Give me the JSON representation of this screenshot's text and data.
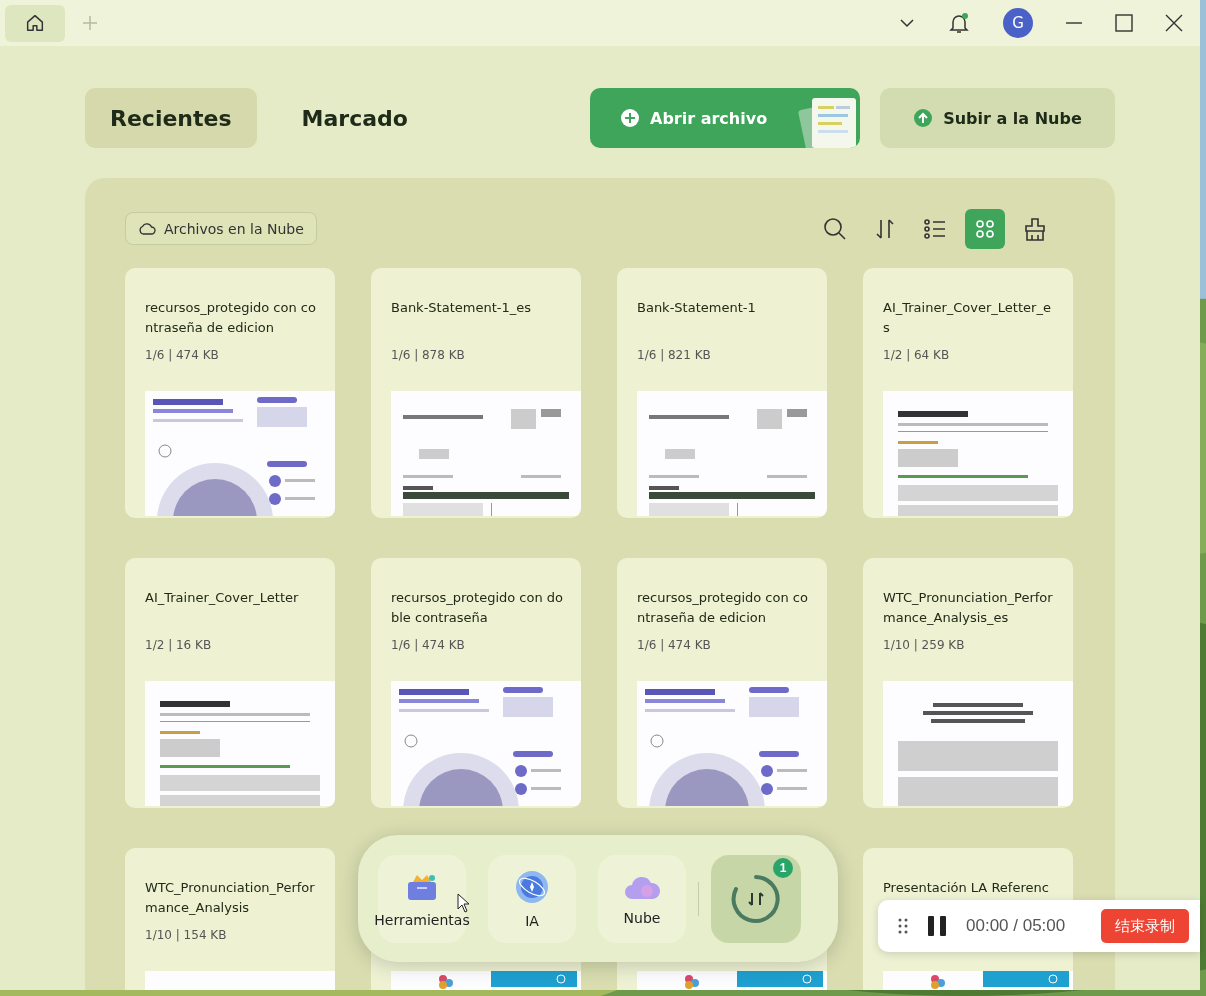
{
  "top_bar": {
    "avatar_initial": "G",
    "has_unread": true
  },
  "tabs": [
    {
      "label": "Recientes",
      "selected": true
    },
    {
      "label": "Marcado",
      "selected": false
    }
  ],
  "actions": [
    {
      "label": "Abrir archivo",
      "kind": "primary"
    },
    {
      "label": "Subir a la Nube",
      "kind": "secondary"
    }
  ],
  "panel": {
    "filter_chip": "Archivos en la Nube",
    "view_tools": [
      {
        "kind": "search",
        "selected": false
      },
      {
        "kind": "sort",
        "selected": false
      },
      {
        "kind": "list",
        "selected": false
      },
      {
        "kind": "grid",
        "selected": true
      },
      {
        "kind": "clean",
        "selected": false
      }
    ]
  },
  "files": [
    {
      "title": "recursos_protegido con contraseña de edicion",
      "info": "1/6 | 474 KB"
    },
    {
      "title": "Bank-Statement-1_es",
      "info": "1/6 | 878 KB"
    },
    {
      "title": "Bank-Statement-1",
      "info": "1/6 | 821 KB"
    },
    {
      "title": "AI_Trainer_Cover_Letter_es",
      "info": "1/2 | 64 KB"
    },
    {
      "title": "AI_Trainer_Cover_Letter",
      "info": "1/2 | 16 KB"
    },
    {
      "title": "recursos_protegido  con doble contraseña",
      "info": "1/6 | 474 KB"
    },
    {
      "title": "recursos_protegido con contraseña de edicion",
      "info": "1/6 | 474 KB"
    },
    {
      "title": "WTC_Pronunciation_Performance_Analysis_es",
      "info": "1/10 | 259 KB"
    },
    {
      "title": "WTC_Pronunciation_Performance_Analysis",
      "info": "1/10 | 154 KB"
    },
    {
      "kind": "picture"
    },
    {
      "kind": "picture"
    },
    {
      "title": "Presentación LA Referenc"
    }
  ],
  "dock": {
    "items": [
      {
        "label": "Herramientas",
        "kind": "tools"
      },
      {
        "label": "IA",
        "kind": "ai"
      },
      {
        "label": "Nube",
        "kind": "cloud"
      }
    ],
    "sync_badge": "1"
  },
  "recorder": {
    "time": "00:00 / 05:00",
    "stop_label": "结束录制"
  }
}
